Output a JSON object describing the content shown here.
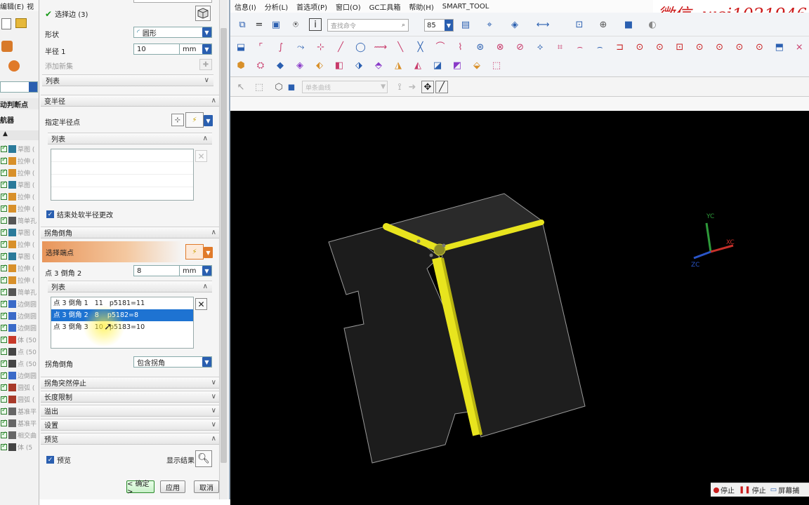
{
  "app_menu": {
    "edit": "编辑(E)",
    "view": "视"
  },
  "menubar": [
    "信息(I)",
    "分析(L)",
    "首选项(P)",
    "窗口(O)",
    "GC工具箱",
    "帮助(H)",
    "SMART_TOOL"
  ],
  "toolbar": {
    "search_placeholder": "查找命令",
    "zoom_value": "85",
    "curve_rule": "单条曲线"
  },
  "watermark": "微信: wei1021946",
  "nav": {
    "header_judge": "动判断点",
    "header_nav": "航器",
    "items": [
      "草图 (",
      "拉伸 (",
      "拉伸 (",
      "草图 (",
      "拉伸 (",
      "拉伸 (",
      "简单孔",
      "草图 (",
      "拉伸 (",
      "草图 (",
      "拉伸 (",
      "拉伸 (",
      "简单孔",
      "边倒圆",
      "边倒圆",
      "边倒圆",
      "体 (50",
      "点 (50",
      "点 (50",
      "边倒圆",
      "圆弧 (",
      "圆弧 (",
      "基准平",
      "基准平",
      "相交曲",
      "体 (5"
    ]
  },
  "dialog": {
    "select_edge": "选择边 (3)",
    "shape_label": "形状",
    "shape_value": "圆形",
    "radius_label": "半径 1",
    "radius_value": "10",
    "radius_unit": "mm",
    "add_new_set": "添加新集",
    "list_label": "列表",
    "variable_radius": "变半径",
    "specify_radius_point": "指定半径点",
    "list_label2": "列表",
    "soften_radius": "结束处软半径更改",
    "corner_setback": "拐角倒角",
    "select_end_point": "选择端点",
    "point_setback_label": "点 3 倒角 2",
    "point_setback_value": "8",
    "point_setback_unit": "mm",
    "list_label3": "列表",
    "setback_items": [
      "点 3 倒角 1   11   p5181=11",
      "点 3 倒角 2   8    p5182=8",
      "点 3 倒角 3   10   p5183=10"
    ],
    "selected_index": 1,
    "corner_setback_label": "拐角倒角",
    "corner_setback_value": "包含拐角",
    "corner_stop": "拐角突然停止",
    "length_limit": "长度限制",
    "overflow": "溢出",
    "settings": "设置",
    "preview": "预览",
    "preview_check": "预览",
    "show_result": "显示结果",
    "ok": "< 确定 >",
    "apply": "应用",
    "cancel": "取消"
  },
  "triad": {
    "yc": "YC",
    "xc": "XC",
    "zc": "ZC"
  },
  "status": {
    "stop1": "停止",
    "stop2": "停止",
    "screen": "屏幕捕"
  },
  "colors": {
    "fillet": "#e8e41e",
    "viewport_bg": "#000000",
    "highlight": "#1e73d2"
  }
}
